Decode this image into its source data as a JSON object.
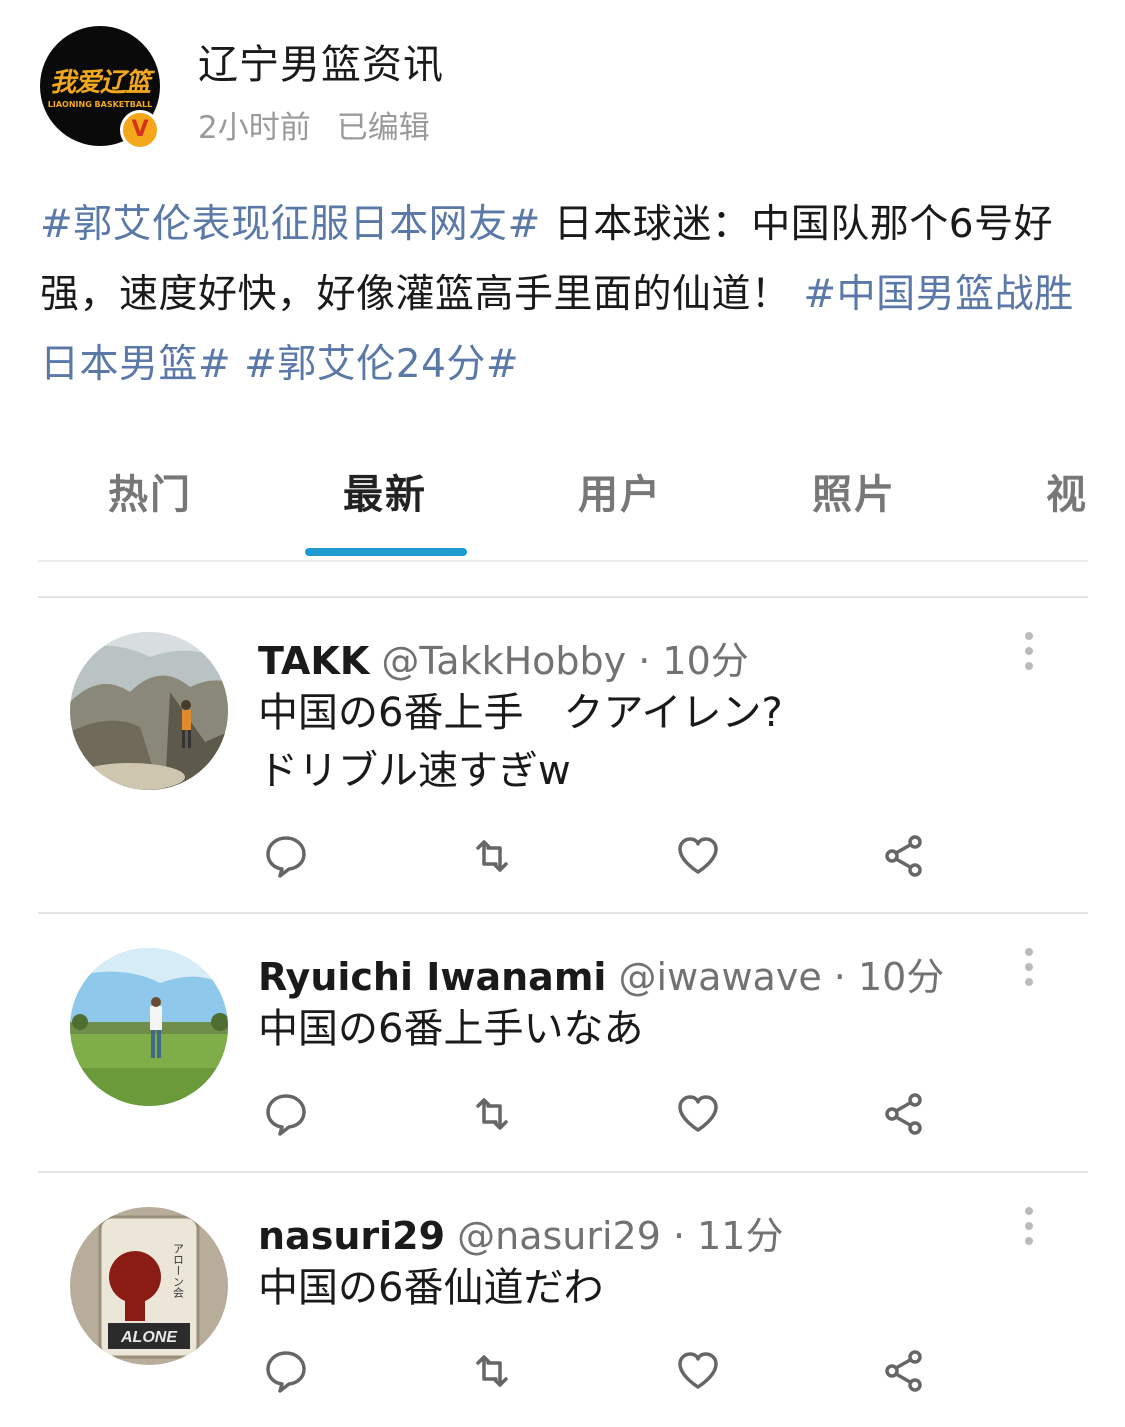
{
  "account": {
    "name": "辽宁男篮资讯",
    "time": "2小时前",
    "edited": "已编辑",
    "logo_text_cn": "我爱辽篮",
    "logo_text_en": "LIAONING BASKETBALL",
    "verified_badge": "V"
  },
  "post": {
    "segments": [
      {
        "type": "tag",
        "text": "#郭艾伦表现征服日本网友#"
      },
      {
        "type": "text",
        "text": " 日本球迷：中国队那个6号好强，速度好快，好像灌篮高手里面的仙道！ "
      },
      {
        "type": "tag",
        "text": "#中国男篮战胜日本男篮#"
      },
      {
        "type": "text",
        "text": " "
      },
      {
        "type": "tag",
        "text": "#郭艾伦24分#"
      }
    ]
  },
  "tabs": [
    {
      "label": "热门",
      "active": false
    },
    {
      "label": "最新",
      "active": true
    },
    {
      "label": "用户",
      "active": false
    },
    {
      "label": "照片",
      "active": false
    },
    {
      "label": "视",
      "active": false
    }
  ],
  "tweets": [
    {
      "name": "TAKK",
      "handle": "@TakkHobby · 10分",
      "body": "中国の6番上手　クアイレン?\nドリブル速すぎw",
      "avatar": "mountain-hiker-photo"
    },
    {
      "name": "Ryuichi Iwanami",
      "handle": "@iwawave · 10分",
      "body": "中国の6番上手いなあ",
      "avatar": "grass-field-person-photo"
    },
    {
      "name": "nasuri29",
      "handle": "@nasuri29 · 11分",
      "body": "中国の6番仙道だわ",
      "avatar": "afro-figure-tag-photo",
      "avatar_text": "アローン会",
      "avatar_logo": "ALONE"
    }
  ],
  "actions": [
    "reply-icon",
    "retweet-icon",
    "like-icon",
    "share-icon"
  ],
  "colors": {
    "hashtag": "#5a78a8",
    "tab_underline": "#1d9bd1",
    "verified_badge": "#f5a71b"
  }
}
